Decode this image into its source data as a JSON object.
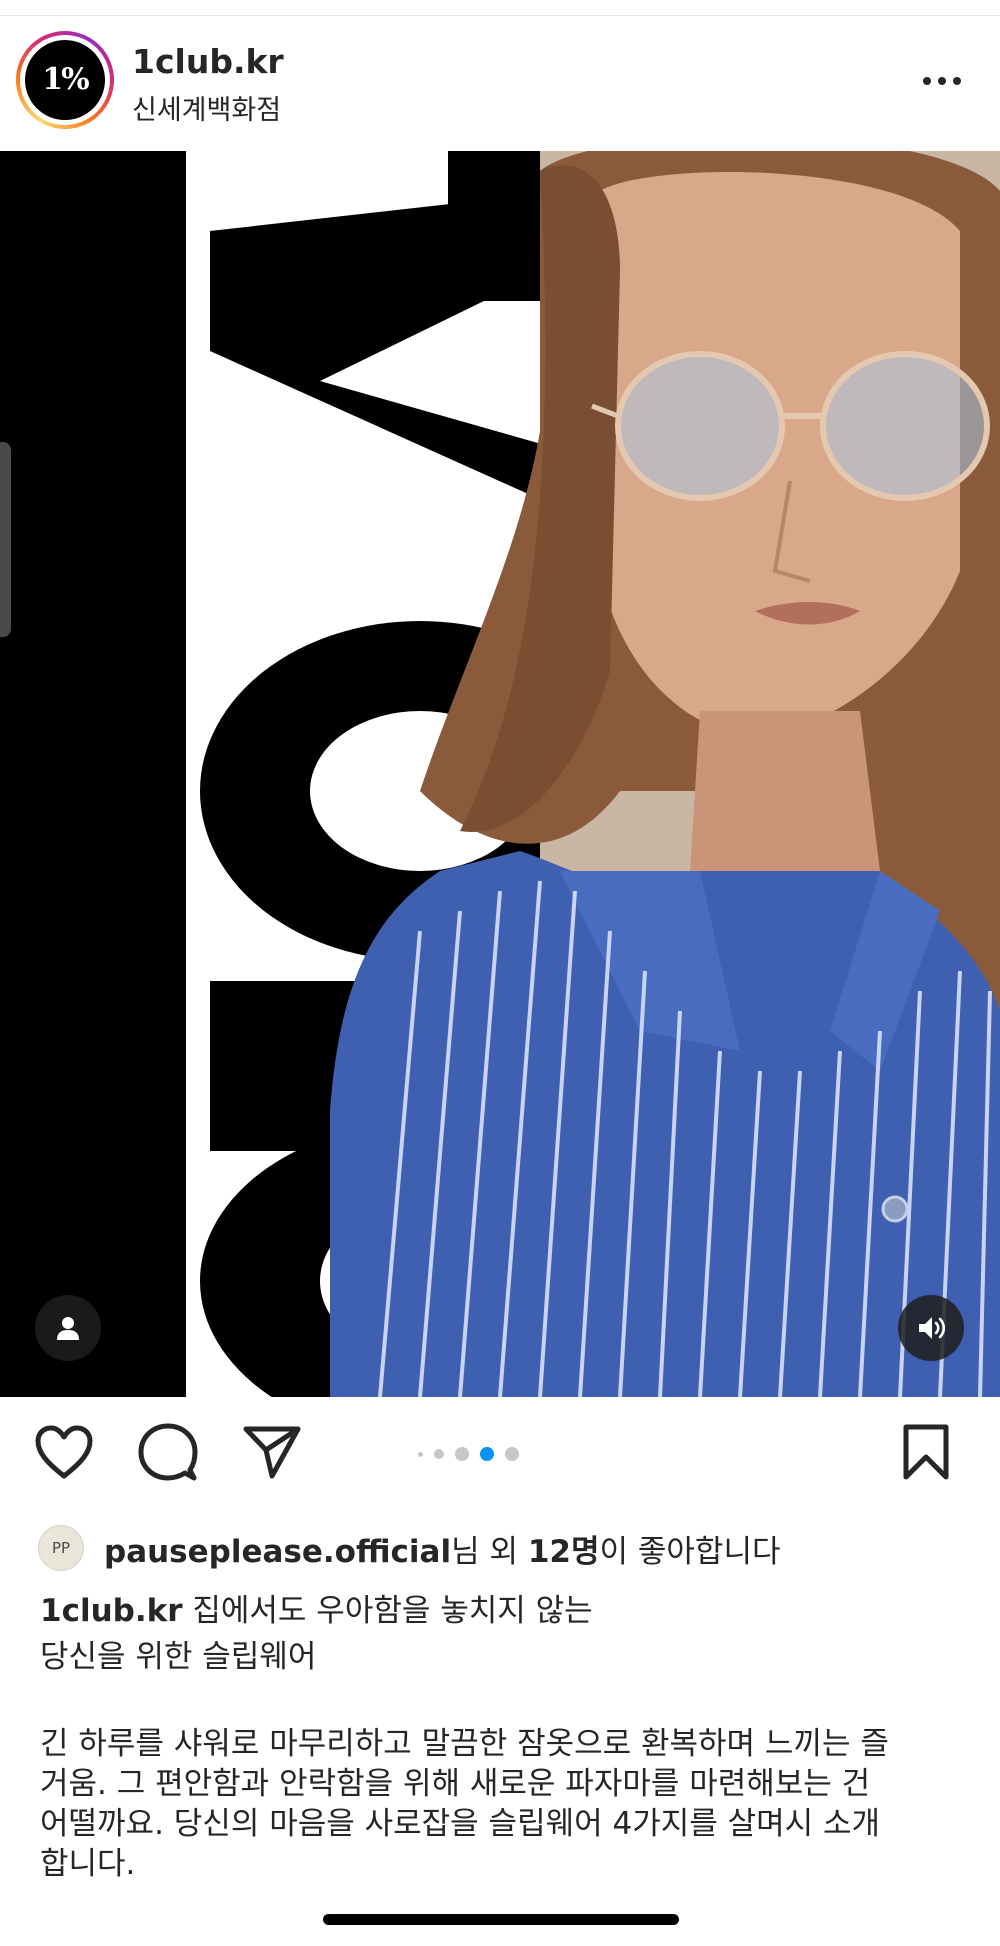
{
  "post": {
    "username": "1club.kr",
    "location": "신세계백화점",
    "avatar_text": "1%",
    "more_label": "more-options"
  },
  "media": {
    "description": "video"
  },
  "carousel": {
    "count": 5,
    "active_index": 3
  },
  "likes": {
    "liker_avatar_initials": "PP",
    "liker_name": "pauseplease.official",
    "middle_text": "님 외 ",
    "count_text": "12명",
    "suffix_text": "이 좋아합니다"
  },
  "caption": {
    "username": "1club.kr",
    "headline_1": "집에서도 우아함을 놓치지 않는",
    "headline_2": "당신을 위한 슬립웨어",
    "body_lines": [
      "긴 하루를 샤워로 마무리하고 말끔한 잠옷으로 환복하며 느끼는 즐",
      "거움. 그 편안함과 안락함을 위해 새로운 파자마를 마련해보는 건",
      "어떨까요. 당신의 마음을 사로잡을 슬립웨어 4가지를 살며시 소개",
      "합니다."
    ]
  },
  "colors": {
    "text": "#262626",
    "accent_blue": "#0095f6",
    "dot_inactive": "#c7c7c7",
    "shirt_blue": "#3f5fb0",
    "hair": "#8a5a3a"
  },
  "icons": {
    "like": "heart-icon",
    "comment": "comment-icon",
    "share": "paper-plane-icon",
    "save": "bookmark-icon",
    "tag": "person-icon",
    "sound": "speaker-icon"
  }
}
